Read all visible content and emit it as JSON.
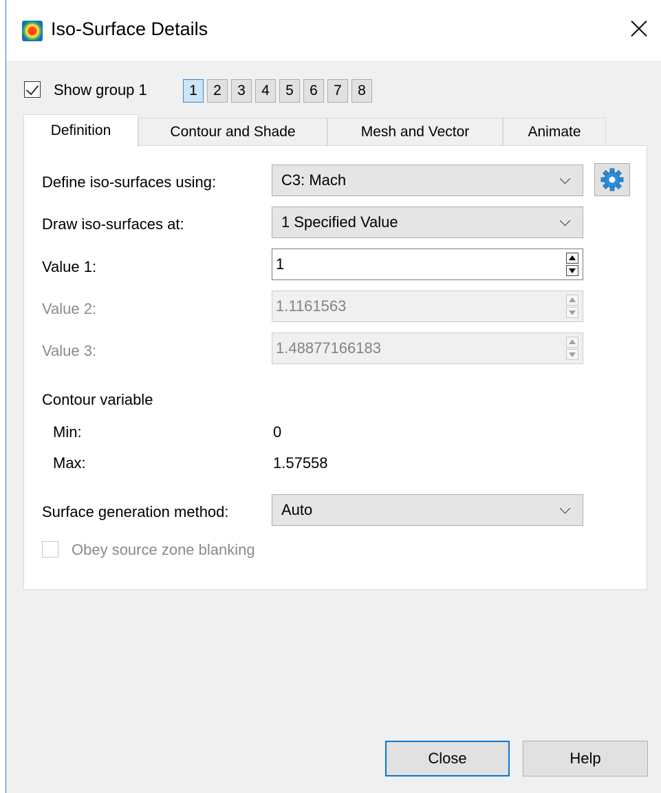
{
  "window": {
    "title": "Iso-Surface Details"
  },
  "group": {
    "show_label": "Show group 1",
    "show_checked": true,
    "buttons": [
      "1",
      "2",
      "3",
      "4",
      "5",
      "6",
      "7",
      "8"
    ],
    "active": "1"
  },
  "tabs": [
    "Definition",
    "Contour and Shade",
    "Mesh and Vector",
    "Animate"
  ],
  "active_tab": "Definition",
  "definition": {
    "define_label": "Define iso-surfaces using:",
    "define_value": "C3: Mach",
    "draw_label": "Draw iso-surfaces at:",
    "draw_value": "1 Specified Value",
    "value1_label": "Value 1:",
    "value1": "1",
    "value2_label": "Value 2:",
    "value2": "1.1161563",
    "value3_label": "Value 3:",
    "value3": "1.48877166183",
    "contour_heading": "Contour variable",
    "min_label": "Min:",
    "min_value": "0",
    "max_label": "Max:",
    "max_value": "1.57558",
    "surface_label": "Surface generation method:",
    "surface_value": "Auto",
    "obey_label": "Obey source zone blanking",
    "obey_checked": false
  },
  "buttons": {
    "close": "Close",
    "help": "Help"
  },
  "colors": {
    "accent": "#0078d7",
    "selected_group": "#cce4f7",
    "gear_icon": "#2a8fdc"
  }
}
